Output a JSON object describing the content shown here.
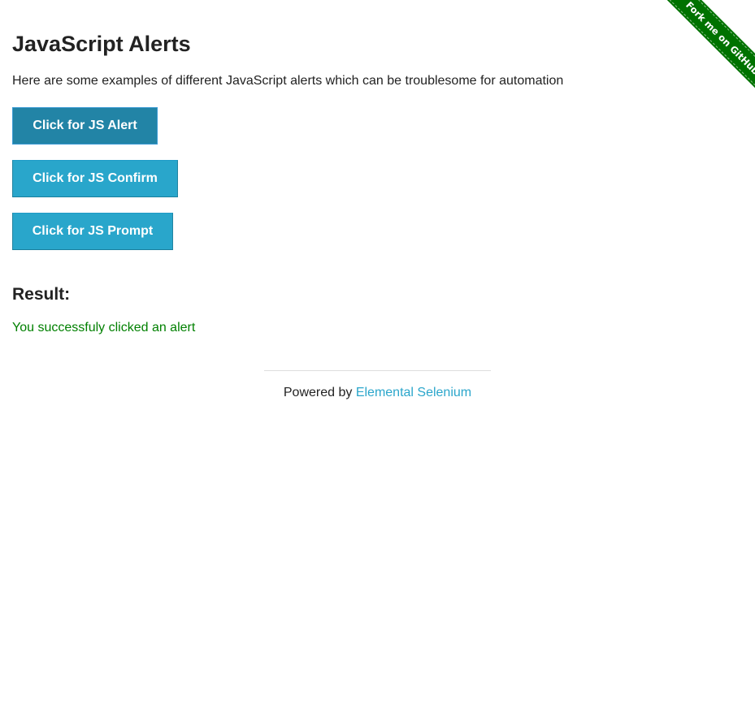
{
  "page": {
    "heading": "JavaScript Alerts",
    "intro": "Here are some examples of different JavaScript alerts which can be troublesome for automation"
  },
  "buttons": {
    "alert_label": "Click for JS Alert",
    "confirm_label": "Click for JS Confirm",
    "prompt_label": "Click for JS Prompt"
  },
  "result": {
    "heading": "Result:",
    "message": "You successfuly clicked an alert"
  },
  "footer": {
    "prefix": "Powered by ",
    "link_label": "Elemental Selenium"
  },
  "ribbon": {
    "label": "Fork me on GitHub"
  },
  "colors": {
    "button": "#29a6cb",
    "button_focused": "#2284a6",
    "result_text": "#008000",
    "link": "#2ba6cb",
    "ribbon": "#007200"
  }
}
